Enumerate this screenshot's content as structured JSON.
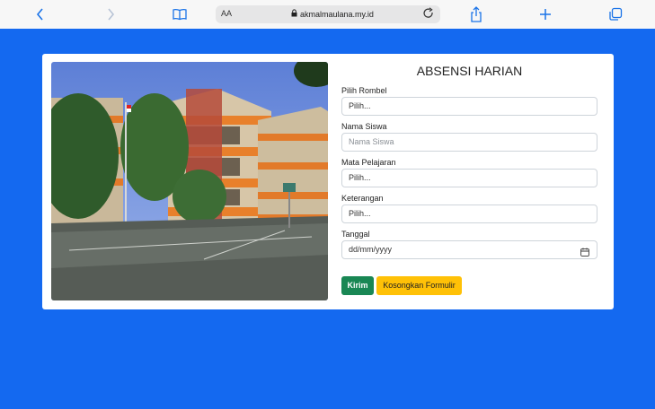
{
  "browser": {
    "address_aa": "AA",
    "url": "akmalmaulana.my.id",
    "icons": [
      "chevron-left-icon",
      "chevron-right-icon",
      "book-icon",
      "lock-icon",
      "reload-icon",
      "share-icon",
      "plus-icon",
      "tabs-icon"
    ]
  },
  "form": {
    "title": "ABSENSI HARIAN",
    "fields": [
      {
        "label": "Pilih Rombel",
        "value": "Pilih..."
      },
      {
        "label": "Nama Siswa",
        "placeholder": "Nama Siswa"
      },
      {
        "label": "Mata Pelajaran",
        "value": "Pilih..."
      },
      {
        "label": "Keterangan",
        "value": "Pilih..."
      },
      {
        "label": "Tanggal",
        "value": "dd/mm/yyyy"
      }
    ],
    "buttons": {
      "submit": "Kirim",
      "reset": "Kosongkan Formulir"
    }
  },
  "colors": {
    "background": "#1469f0",
    "submit": "#198754",
    "reset": "#ffc107",
    "accent": "#1a73e8"
  }
}
